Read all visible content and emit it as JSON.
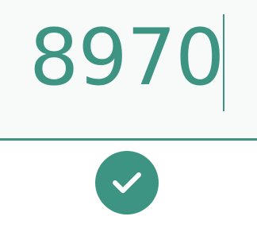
{
  "input": {
    "value": "8970"
  },
  "confirm_button": {
    "icon": "check-icon"
  },
  "colors": {
    "accent": "#3d9482",
    "input_background": "#f7faf8",
    "page_background": "#ffffff"
  }
}
